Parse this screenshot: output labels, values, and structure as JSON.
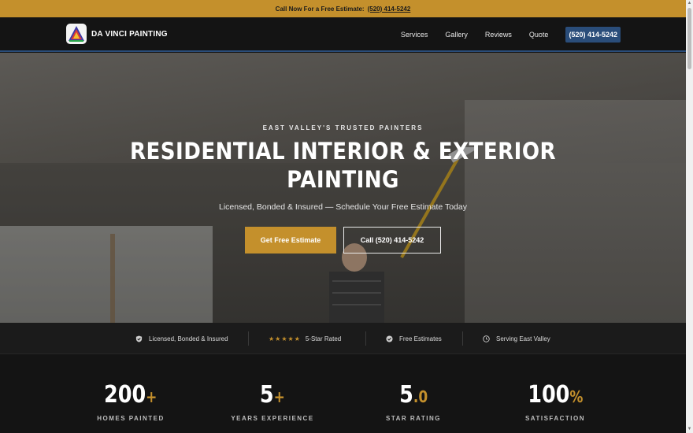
{
  "topbar": {
    "text": "Call Now For a Free Estimate:",
    "phone": "(520) 414-5242"
  },
  "header": {
    "brand": "DA VINCI PAINTING",
    "logo_icon": "brand-logo-icon",
    "nav": [
      {
        "label": "Services"
      },
      {
        "label": "Gallery"
      },
      {
        "label": "Reviews"
      },
      {
        "label": "Quote"
      }
    ],
    "cta_label": "(520) 414-5242",
    "colors": {
      "accent": "#c4902c",
      "nav_cta": "#2a4d7a"
    }
  },
  "hero": {
    "eyebrow": "EAST VALLEY'S TRUSTED PAINTERS",
    "title_line1": "Residential Interior & Exterior",
    "title_line2": "Painting",
    "subtitle": "Licensed, Bonded & Insured — Schedule Your Free Estimate Today",
    "primary_button": "Get Free Estimate",
    "secondary_button": "Call (520) 414-5242"
  },
  "trust": [
    {
      "icon": "shield-check-icon",
      "label": "Licensed, Bonded & Insured"
    },
    {
      "icon": "star-icon",
      "label": "5-Star Rated",
      "stars": 5
    },
    {
      "icon": "check-circle-icon",
      "label": "Free Estimates"
    },
    {
      "icon": "clock-icon",
      "label": "Serving East Valley"
    }
  ],
  "stats": [
    {
      "value": "200",
      "suffix": "+",
      "label": "HOMES PAINTED"
    },
    {
      "value": "5",
      "suffix": "+",
      "label": "YEARS EXPERIENCE"
    },
    {
      "value": "5",
      "suffix": ".0",
      "label": "STAR RATING"
    },
    {
      "value": "100",
      "suffix": "%",
      "label": "SATISFACTION"
    }
  ]
}
